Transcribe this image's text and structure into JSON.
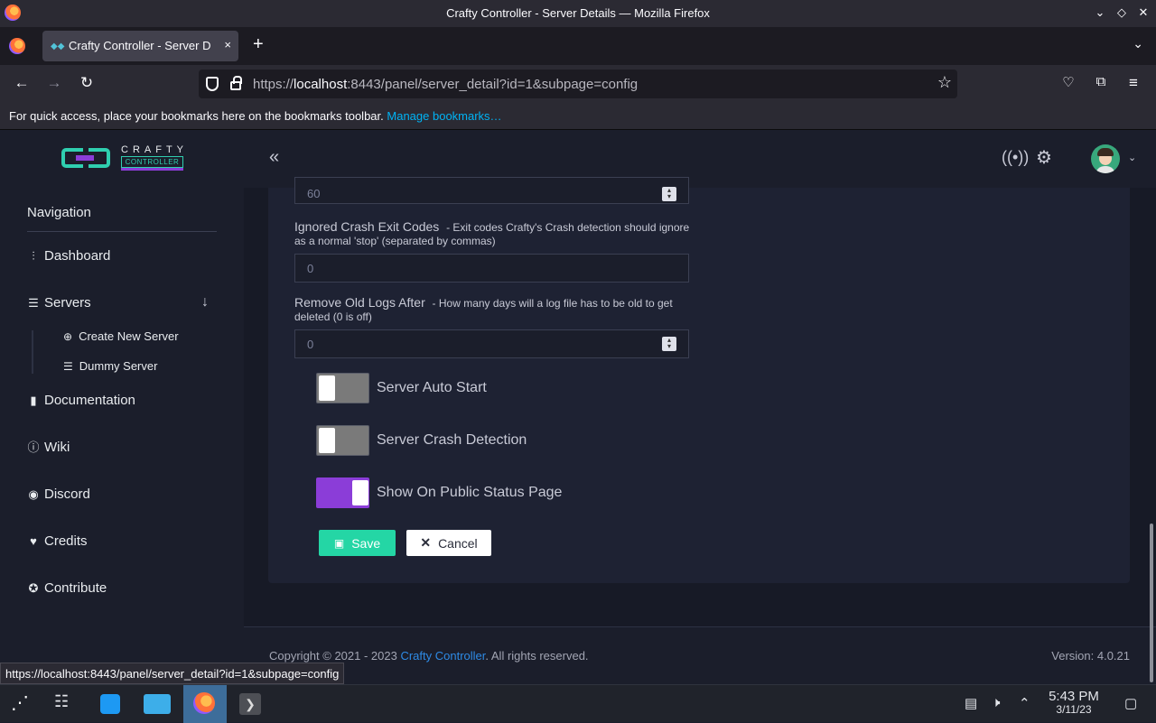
{
  "window": {
    "title": "Crafty Controller - Server Details — Mozilla Firefox",
    "controls": [
      "chevron-down-icon",
      "diamond-icon",
      "close-icon"
    ]
  },
  "tabs": [
    {
      "label": "Crafty Controller - Server Details",
      "close": "×"
    }
  ],
  "newtab_label": "+",
  "urlbar": {
    "url_prefix": "https://",
    "host": "localhost",
    "url_rest": ":8443/panel/server_detail?id=1&subpage=config"
  },
  "bookmarks": {
    "message": "For quick access, place your bookmarks here on the bookmarks toolbar.",
    "link": "Manage bookmarks…"
  },
  "header": {
    "logo_word": "CRAFTY",
    "logo_sub": "CONTROLLER",
    "collapse_glyph": "«"
  },
  "sidebar": {
    "heading": "Navigation",
    "items": [
      {
        "label": "Dashboard",
        "icon": "sitemap-icon"
      },
      {
        "label": "Servers",
        "icon": "server-icon"
      },
      {
        "label": "Documentation",
        "icon": "book-icon"
      },
      {
        "label": "Wiki",
        "icon": "info-icon"
      },
      {
        "label": "Discord",
        "icon": "discord-icon"
      },
      {
        "label": "Credits",
        "icon": "heart-icon"
      },
      {
        "label": "Contribute",
        "icon": "award-icon"
      }
    ],
    "subitems": [
      {
        "label": "Create New Server",
        "icon": "plus-circle-icon"
      },
      {
        "label": "Dummy Server",
        "icon": "server-icon"
      }
    ]
  },
  "form": {
    "top_value": "60",
    "crash_codes": {
      "label": "Ignored Crash Exit Codes",
      "help": "- Exit codes Crafty's Crash detection should ignore as a normal 'stop' (separated by commas)",
      "value": "0"
    },
    "old_logs": {
      "label": "Remove Old Logs After",
      "help": "- How many days will a log file has to be old to get deleted (0 is off)",
      "value": "0"
    },
    "toggles": [
      {
        "label": "Server Auto Start",
        "on": false
      },
      {
        "label": "Server Crash Detection",
        "on": false
      },
      {
        "label": "Show On Public Status Page",
        "on": true
      }
    ],
    "save_label": "Save",
    "cancel_label": "Cancel"
  },
  "footer": {
    "copyright_prefix": "Copyright © 2021 - 2023 ",
    "copyright_link": "Crafty Controller",
    "copyright_suffix": ". All rights reserved.",
    "version": "Version: 4.0.21"
  },
  "status_url": "https://localhost:8443/panel/server_detail?id=1&subpage=config",
  "taskbar": {
    "time": "5:43 PM",
    "date": "3/11/23"
  },
  "colors": {
    "accent": "#8b3dd8",
    "save": "#24d6a5",
    "brand_teal": "#2fcfb0",
    "link": "#2e8be6"
  }
}
